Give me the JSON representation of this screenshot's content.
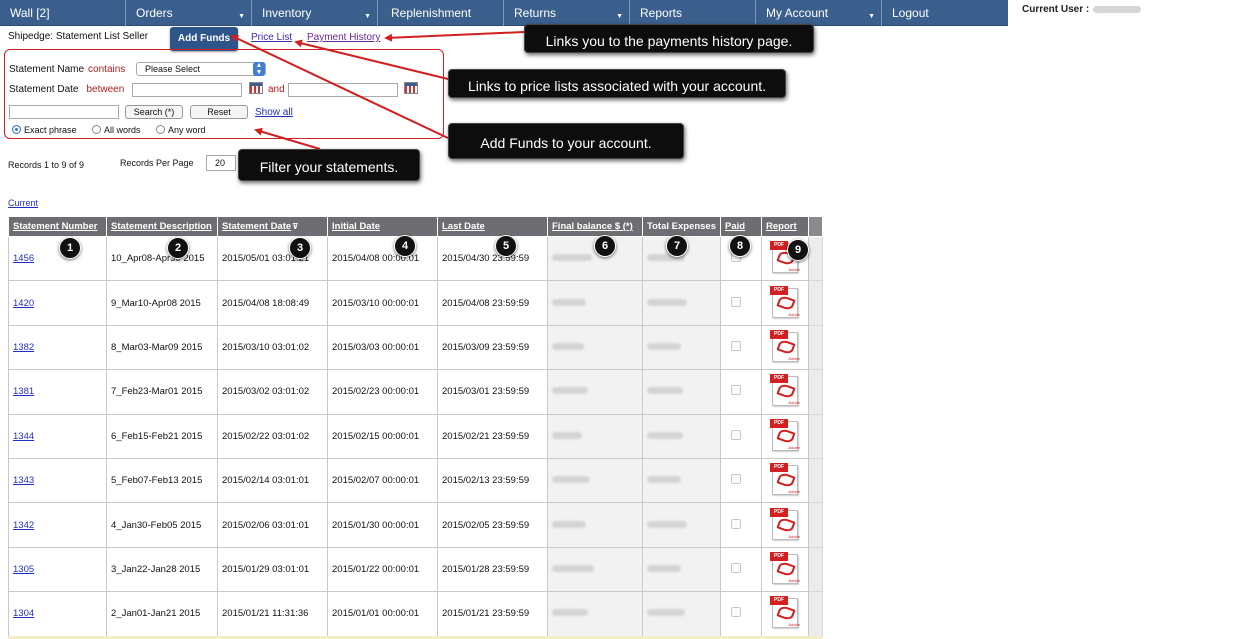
{
  "nav": {
    "items": [
      {
        "label": "Wall [2]",
        "dropdown": false
      },
      {
        "label": "Orders",
        "dropdown": true
      },
      {
        "label": "Inventory",
        "dropdown": true
      },
      {
        "label": "Replenishment",
        "dropdown": false
      },
      {
        "label": "Returns",
        "dropdown": true
      },
      {
        "label": "Reports",
        "dropdown": false
      },
      {
        "label": "My Account",
        "dropdown": true
      },
      {
        "label": "Logout",
        "dropdown": false
      }
    ],
    "current_user_label": "Current User :"
  },
  "subbar": {
    "page_title": "Shipedge: Statement List Seller",
    "add_funds": "Add Funds",
    "price_list": "Price List",
    "payment_history": "Payment History"
  },
  "filter": {
    "statement_name_label": "Statement Name",
    "statement_name_op": "contains",
    "statement_name_value": "Please Select",
    "statement_date_label": "Statement Date",
    "statement_date_op": "between",
    "and_label": "and",
    "search_button": "Search (*)",
    "reset_button": "Reset",
    "show_all": "Show all",
    "modes": [
      "Exact phrase",
      "All words",
      "Any word"
    ],
    "selected_mode": "Exact phrase"
  },
  "records": {
    "summary": "Records 1 to 9 of 9",
    "per_page_label": "Records Per Page",
    "per_page_value": "20",
    "current_link": "Current"
  },
  "table": {
    "headers": [
      "Statement Number",
      "Statement Description",
      "Statement Date",
      "Initial Date",
      "Last Date",
      "Final balance $ (*)",
      "Total Expenses",
      "Paid",
      "Report"
    ],
    "rows": [
      {
        "number": "1456",
        "description": "10_Apr08-Apr30 2015",
        "date": "2015/05/01 03:01:21",
        "initial": "2015/04/08 00:00:01",
        "last": "2015/04/30 23:59:59"
      },
      {
        "number": "1420",
        "description": "9_Mar10-Apr08 2015",
        "date": "2015/04/08 18:08:49",
        "initial": "2015/03/10 00:00:01",
        "last": "2015/04/08 23:59:59"
      },
      {
        "number": "1382",
        "description": "8_Mar03-Mar09 2015",
        "date": "2015/03/10 03:01:02",
        "initial": "2015/03/03 00:00:01",
        "last": "2015/03/09 23:59:59"
      },
      {
        "number": "1381",
        "description": "7_Feb23-Mar01 2015",
        "date": "2015/03/02 03:01:02",
        "initial": "2015/02/23 00:00:01",
        "last": "2015/03/01 23:59:59"
      },
      {
        "number": "1344",
        "description": "6_Feb15-Feb21 2015",
        "date": "2015/02/22 03:01:02",
        "initial": "2015/02/15 00:00:01",
        "last": "2015/02/21 23:59:59"
      },
      {
        "number": "1343",
        "description": "5_Feb07-Feb13 2015",
        "date": "2015/02/14 03:01:01",
        "initial": "2015/02/07 00:00:01",
        "last": "2015/02/13 23:59:59"
      },
      {
        "number": "1342",
        "description": "4_Jan30-Feb05 2015",
        "date": "2015/02/06 03:01:01",
        "initial": "2015/01/30 00:00:01",
        "last": "2015/02/05 23:59:59"
      },
      {
        "number": "1305",
        "description": "3_Jan22-Jan28 2015",
        "date": "2015/01/29 03:01:01",
        "initial": "2015/01/22 00:00:01",
        "last": "2015/01/28 23:59:59"
      },
      {
        "number": "1304",
        "description": "2_Jan01-Jan21 2015",
        "date": "2015/01/21 11:31:36",
        "initial": "2015/01/01 00:00:01",
        "last": "2015/01/21 23:59:59"
      }
    ],
    "report_icon": "pdf-icon"
  },
  "badges": [
    "1",
    "2",
    "3",
    "4",
    "5",
    "6",
    "7",
    "8",
    "9"
  ],
  "callouts": {
    "payment_history": "Links you to the payments history page.",
    "price_list": "Links to price lists associated with your account.",
    "add_funds": "Add Funds to your account.",
    "filter": "Filter your statements."
  },
  "colors": {
    "nav_bg": "#3a5f8c",
    "header_bg": "#6e6e72",
    "annotation_red": "#d02020",
    "callout_bg": "#0d0d0d"
  }
}
